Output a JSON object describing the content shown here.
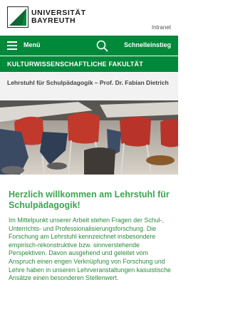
{
  "header": {
    "logo_line1": "UNIVERSITÄT",
    "logo_line2": "BAYREUTH",
    "intranet_label": "Intranet"
  },
  "nav": {
    "menu_label": "Menü",
    "quick_access_label": "Schnelleinstieg",
    "icons": [
      "menu-icon",
      "search-icon"
    ]
  },
  "faculty": {
    "title": "KULTURWISSENSCHAFTLICHE FAKULTÄT"
  },
  "chair": {
    "title": "Lehrstuhl für Schulpädagogik – Prof. Dr. Fabian Dietrich"
  },
  "main": {
    "welcome_heading": "Herzlich willkommen am Lehrstuhl für Schulpädagogik!",
    "intro_text": "Im Mittelpunkt unserer Arbeit stehen Fragen der Schul-, Unterrichts- und Professionalisierungsforschung. Die Forschung am Lehrstuhl kennzeichnet insbesondere empirisch-rekonstruktive bzw. sinnverstehende Perspektiven. Davon ausgehend und geleitet vom Anspruch einen engen Verknüpfung von Forschung und Lehre haben in unseren Lehrveranstaltungen kasuistische Ansätze einen besonderen Stellenwert."
  },
  "colors": {
    "brand_green": "#00893a",
    "text_green": "#2e8b3f",
    "chair_bar": "#f2f2f2"
  }
}
